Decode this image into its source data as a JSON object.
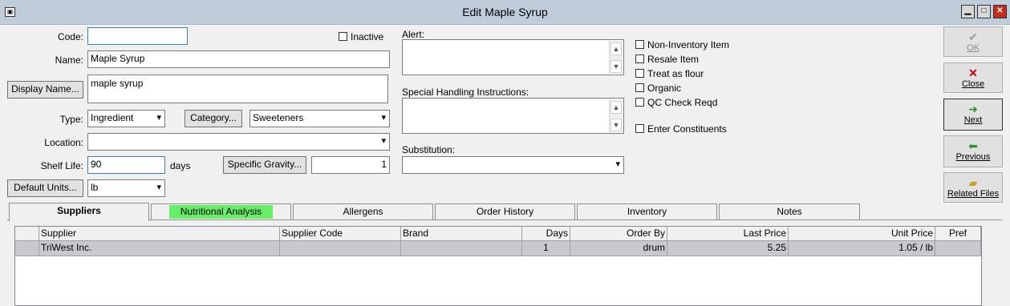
{
  "window": {
    "title": "Edit Maple Syrup",
    "minimize": "▁",
    "maximize": "□",
    "close": "✕"
  },
  "form": {
    "code_label": "Code:",
    "code_value": "",
    "inactive_label": "Inactive",
    "name_label": "Name:",
    "name_value": "Maple Syrup",
    "display_name_button": "Display Name...",
    "display_name_value": "maple syrup",
    "type_label": "Type:",
    "type_value": "Ingredient",
    "category_button": "Category...",
    "category_value": "Sweeteners",
    "location_label": "Location:",
    "location_value": "",
    "shelf_life_label": "Shelf Life:",
    "shelf_life_value": "90",
    "shelf_life_unit": "days",
    "specific_gravity_button": "Specific Gravity...",
    "specific_gravity_value": "1",
    "default_units_button": "Default Units...",
    "default_units_value": "lb",
    "alert_label": "Alert:",
    "special_handling_label": "Special Handling Instructions:",
    "substitution_label": "Substitution:",
    "substitution_value": ""
  },
  "checkboxes": [
    {
      "label": "Non-Inventory Item",
      "checked": false
    },
    {
      "label": "Resale Item",
      "checked": false
    },
    {
      "label": "Treat as flour",
      "checked": false
    },
    {
      "label": "Organic",
      "checked": false
    },
    {
      "label": "QC Check Reqd",
      "checked": false
    },
    {
      "label": "Enter Constituents",
      "checked": false
    }
  ],
  "side_buttons": [
    {
      "label": "OK",
      "icon": "check-icon",
      "enabled": false
    },
    {
      "label": "Close",
      "icon": "close-x-icon",
      "enabled": true
    },
    {
      "label": "Next",
      "icon": "next-arrow-icon",
      "enabled": true
    },
    {
      "label": "Previous",
      "icon": "previous-arrow-icon",
      "enabled": true
    },
    {
      "label": "Related Files",
      "icon": "folder-icon",
      "enabled": true
    }
  ],
  "tabs": [
    {
      "label": "Suppliers",
      "active": true
    },
    {
      "label": "Nutritional Analysis",
      "highlight": "#66ee66"
    },
    {
      "label": "Allergens"
    },
    {
      "label": "Order History"
    },
    {
      "label": "Inventory"
    },
    {
      "label": "Notes"
    }
  ],
  "suppliers_table": {
    "columns": [
      "Supplier",
      "Supplier Code",
      "Brand",
      "Days",
      "Order By",
      "Last Price",
      "Unit Price",
      "Pref"
    ],
    "rows": [
      [
        "TriWest Inc.",
        "",
        "",
        "1",
        "drum",
        "5.25",
        "1.05 / lb",
        ""
      ]
    ]
  },
  "colors": {
    "titlebar": "#bfcddb",
    "selected_row": "#c8c8d0",
    "nutrition_tab_highlight": "#66ee66",
    "close_icon": "#cc0000",
    "next_icon": "#2f8f2f"
  }
}
